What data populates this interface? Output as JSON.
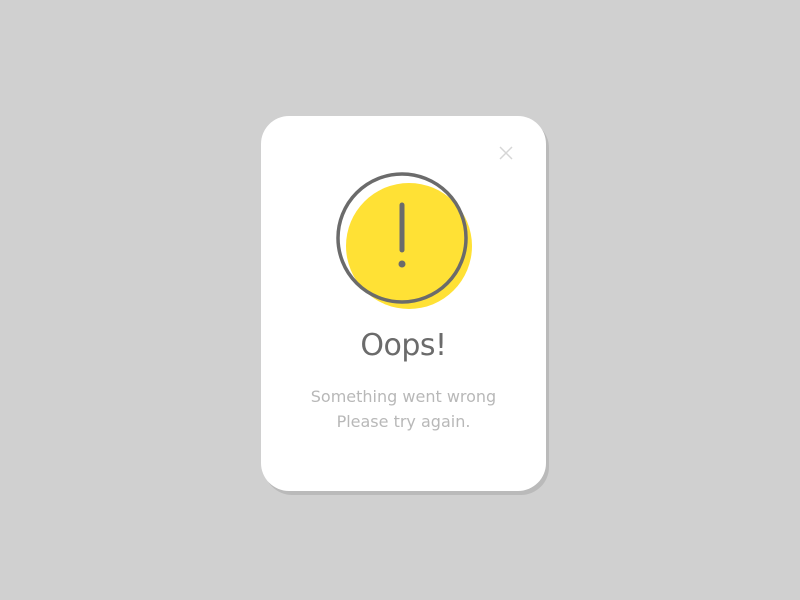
{
  "dialog": {
    "title": "Oops!",
    "message_line1": "Something went wrong",
    "message_line2": "Please try again.",
    "icon": "exclamation-circle-icon",
    "close_icon": "close-icon"
  },
  "colors": {
    "background": "#d0d0d0",
    "card": "#ffffff",
    "accent_yellow": "#ffe135",
    "icon_stroke": "#6b6b6b",
    "title_text": "#6b6b6b",
    "message_text": "#b8b8b8",
    "close_icon": "#d6d6d6"
  }
}
